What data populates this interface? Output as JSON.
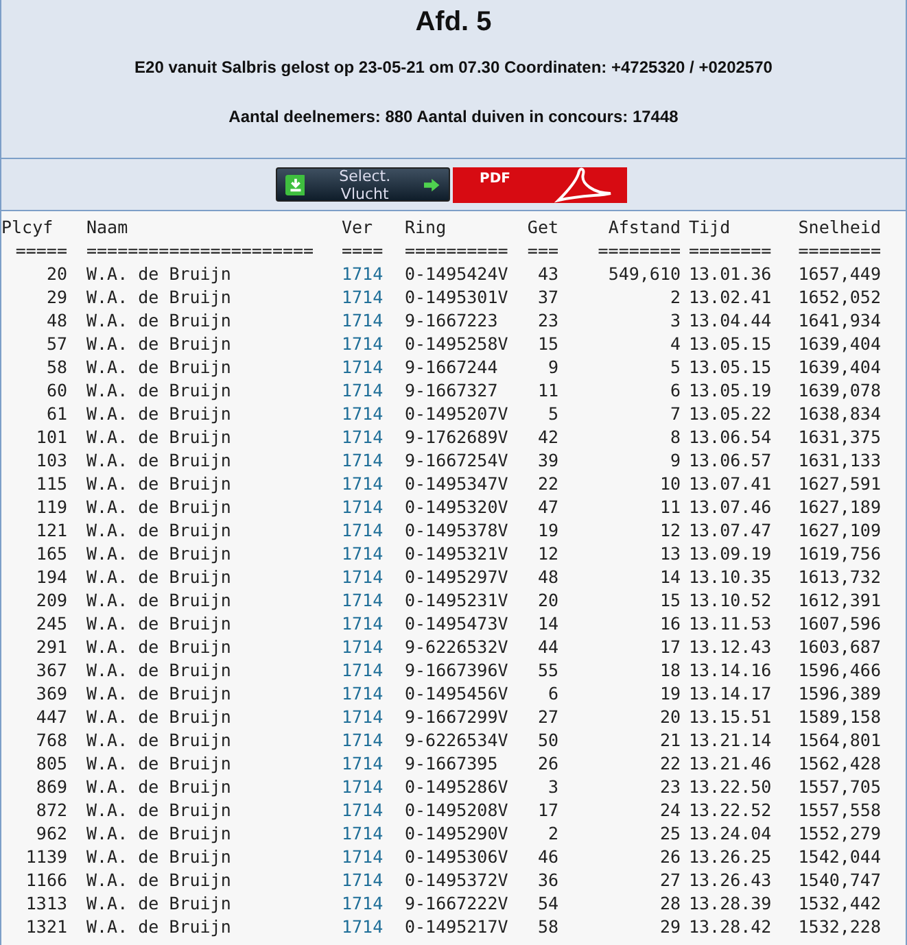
{
  "title": "Afd. 5",
  "info_lines": [
    "E20 vanuit Salbris gelost op 23-05-21 om 07.30 Coordinaten: +4725320 / +0202570",
    "Aantal deelnemers: 880 Aantal duiven in concours: 17448"
  ],
  "buttons": [
    {
      "kind": "select",
      "label": "Select. Vlucht"
    },
    {
      "kind": "pdf",
      "label": "PDF"
    }
  ],
  "table": {
    "columns": [
      {
        "label": "Plcyf",
        "rule": "====="
      },
      {
        "label": "Naam",
        "rule": "======================"
      },
      {
        "label": "Ver",
        "rule": "===="
      },
      {
        "label": "Ring",
        "rule": "=========="
      },
      {
        "label": "Get",
        "rule": "==="
      },
      {
        "label": "Afstand",
        "rule": "========"
      },
      {
        "label": "Tijd",
        "rule": "========"
      },
      {
        "label": "Snelheid",
        "rule": "========"
      }
    ],
    "rows": [
      [
        "20",
        "W.A. de Bruijn",
        "1714",
        "0-1495424V",
        "43",
        "549,610",
        "13.01.36",
        "1657,449"
      ],
      [
        "29",
        "W.A. de Bruijn",
        "1714",
        "0-1495301V",
        "37",
        "2",
        "13.02.41",
        "1652,052"
      ],
      [
        "48",
        "W.A. de Bruijn",
        "1714",
        "9-1667223",
        "23",
        "3",
        "13.04.44",
        "1641,934"
      ],
      [
        "57",
        "W.A. de Bruijn",
        "1714",
        "0-1495258V",
        "15",
        "4",
        "13.05.15",
        "1639,404"
      ],
      [
        "58",
        "W.A. de Bruijn",
        "1714",
        "9-1667244",
        "9",
        "5",
        "13.05.15",
        "1639,404"
      ],
      [
        "60",
        "W.A. de Bruijn",
        "1714",
        "9-1667327",
        "11",
        "6",
        "13.05.19",
        "1639,078"
      ],
      [
        "61",
        "W.A. de Bruijn",
        "1714",
        "0-1495207V",
        "5",
        "7",
        "13.05.22",
        "1638,834"
      ],
      [
        "101",
        "W.A. de Bruijn",
        "1714",
        "9-1762689V",
        "42",
        "8",
        "13.06.54",
        "1631,375"
      ],
      [
        "103",
        "W.A. de Bruijn",
        "1714",
        "9-1667254V",
        "39",
        "9",
        "13.06.57",
        "1631,133"
      ],
      [
        "115",
        "W.A. de Bruijn",
        "1714",
        "0-1495347V",
        "22",
        "10",
        "13.07.41",
        "1627,591"
      ],
      [
        "119",
        "W.A. de Bruijn",
        "1714",
        "0-1495320V",
        "47",
        "11",
        "13.07.46",
        "1627,189"
      ],
      [
        "121",
        "W.A. de Bruijn",
        "1714",
        "0-1495378V",
        "19",
        "12",
        "13.07.47",
        "1627,109"
      ],
      [
        "165",
        "W.A. de Bruijn",
        "1714",
        "0-1495321V",
        "12",
        "13",
        "13.09.19",
        "1619,756"
      ],
      [
        "194",
        "W.A. de Bruijn",
        "1714",
        "0-1495297V",
        "48",
        "14",
        "13.10.35",
        "1613,732"
      ],
      [
        "209",
        "W.A. de Bruijn",
        "1714",
        "0-1495231V",
        "20",
        "15",
        "13.10.52",
        "1612,391"
      ],
      [
        "245",
        "W.A. de Bruijn",
        "1714",
        "0-1495473V",
        "14",
        "16",
        "13.11.53",
        "1607,596"
      ],
      [
        "291",
        "W.A. de Bruijn",
        "1714",
        "9-6226532V",
        "44",
        "17",
        "13.12.43",
        "1603,687"
      ],
      [
        "367",
        "W.A. de Bruijn",
        "1714",
        "9-1667396V",
        "55",
        "18",
        "13.14.16",
        "1596,466"
      ],
      [
        "369",
        "W.A. de Bruijn",
        "1714",
        "0-1495456V",
        "6",
        "19",
        "13.14.17",
        "1596,389"
      ],
      [
        "447",
        "W.A. de Bruijn",
        "1714",
        "9-1667299V",
        "27",
        "20",
        "13.15.51",
        "1589,158"
      ],
      [
        "768",
        "W.A. de Bruijn",
        "1714",
        "9-6226534V",
        "50",
        "21",
        "13.21.14",
        "1564,801"
      ],
      [
        "805",
        "W.A. de Bruijn",
        "1714",
        "9-1667395",
        "26",
        "22",
        "13.21.46",
        "1562,428"
      ],
      [
        "869",
        "W.A. de Bruijn",
        "1714",
        "0-1495286V",
        "3",
        "23",
        "13.22.50",
        "1557,705"
      ],
      [
        "872",
        "W.A. de Bruijn",
        "1714",
        "0-1495208V",
        "17",
        "24",
        "13.22.52",
        "1557,558"
      ],
      [
        "962",
        "W.A. de Bruijn",
        "1714",
        "0-1495290V",
        "2",
        "25",
        "13.24.04",
        "1552,279"
      ],
      [
        "1139",
        "W.A. de Bruijn",
        "1714",
        "0-1495306V",
        "46",
        "26",
        "13.26.25",
        "1542,044"
      ],
      [
        "1166",
        "W.A. de Bruijn",
        "1714",
        "0-1495372V",
        "36",
        "27",
        "13.26.43",
        "1540,747"
      ],
      [
        "1313",
        "W.A. de Bruijn",
        "1714",
        "9-1667222V",
        "54",
        "28",
        "13.28.39",
        "1532,442"
      ],
      [
        "1321",
        "W.A. de Bruijn",
        "1714",
        "0-1495217V",
        "58",
        "29",
        "13.28.42",
        "1532,228"
      ]
    ]
  }
}
